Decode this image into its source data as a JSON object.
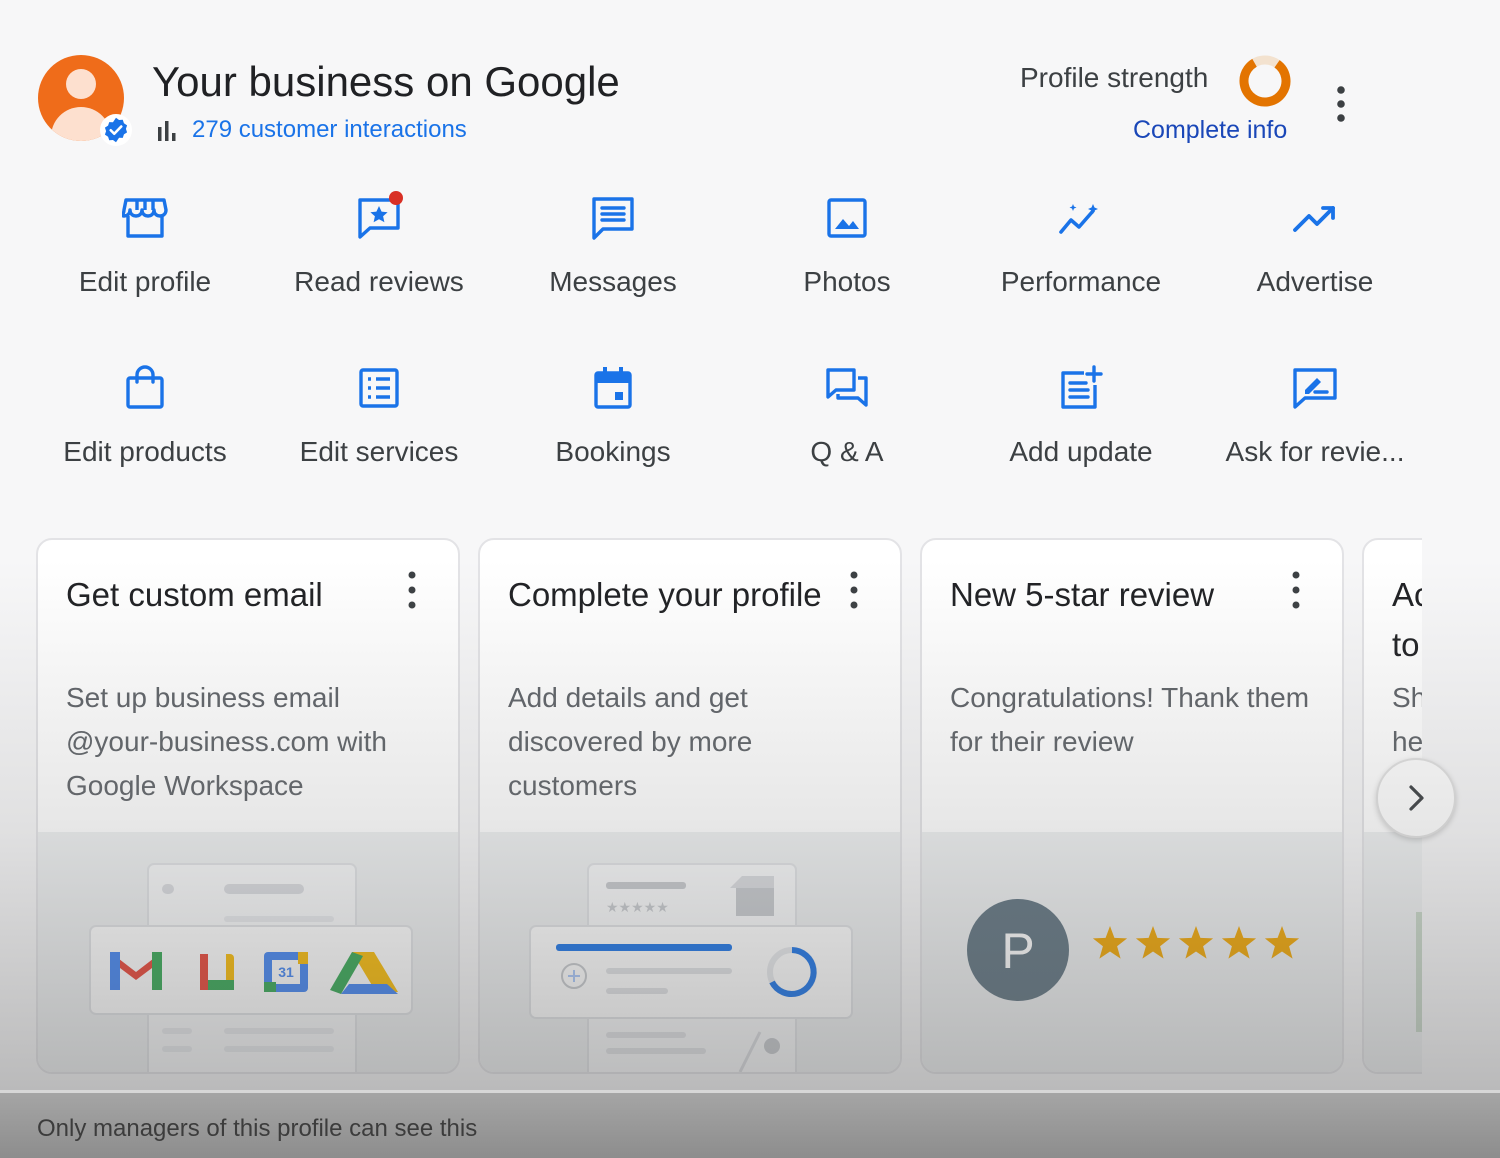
{
  "header": {
    "title": "Your business on Google",
    "interactions": "279 customer interactions",
    "profile_strength_label": "Profile strength",
    "complete_info": "Complete info"
  },
  "actions": [
    {
      "label": "Edit profile",
      "icon": "storefront-icon"
    },
    {
      "label": "Read reviews",
      "icon": "star-review-icon",
      "badge": true
    },
    {
      "label": "Messages",
      "icon": "message-icon"
    },
    {
      "label": "Photos",
      "icon": "photo-icon"
    },
    {
      "label": "Performance",
      "icon": "performance-icon"
    },
    {
      "label": "Advertise",
      "icon": "trending-up-icon"
    },
    {
      "label": "Edit products",
      "icon": "shopping-bag-icon"
    },
    {
      "label": "Edit services",
      "icon": "list-icon"
    },
    {
      "label": "Bookings",
      "icon": "calendar-icon"
    },
    {
      "label": "Q & A",
      "icon": "forum-icon"
    },
    {
      "label": "Add update",
      "icon": "post-add-icon"
    },
    {
      "label": "Ask for revie...",
      "icon": "rate-review-icon"
    }
  ],
  "cards": [
    {
      "title": "Get custom email",
      "description": "Set up business email @your-business.com with Google Workspace",
      "calendar_date": "31"
    },
    {
      "title": "Complete your profile",
      "description": "Add details and get discovered by more customers"
    },
    {
      "title": "New 5-star review",
      "description": "Congratulations! Thank them for their review",
      "reviewer_initial": "P",
      "rating": 5
    },
    {
      "title_line1": "Ac",
      "title_line2": "to",
      "desc_line1": "Sh",
      "desc_line2": "he"
    }
  ],
  "footer": {
    "text": "Only managers of this profile can see this"
  },
  "colors": {
    "accent_blue": "#1a73e8",
    "avatar_orange": "#ef6c1a",
    "star": "#f2a600",
    "reviewer_avatar": "#5f7380"
  }
}
